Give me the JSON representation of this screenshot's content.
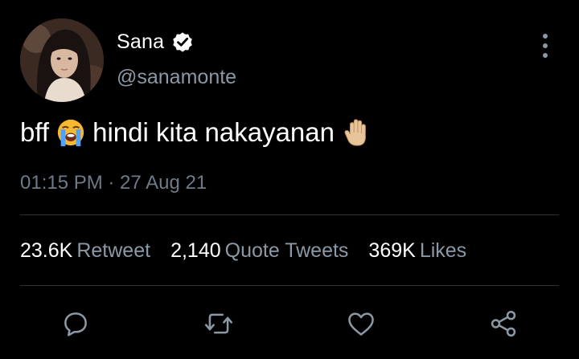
{
  "user": {
    "display_name": "Sana",
    "handle": "@sanamonte",
    "verified": true
  },
  "tweet": {
    "text_part1": "bff",
    "emoji1": "loudly-crying-face",
    "text_part2": "hindi kita nakayanan",
    "emoji2": "raised-hand"
  },
  "timestamp": "01:15 PM · 27 Aug 21",
  "stats": {
    "retweets_count": "23.6K",
    "retweets_label": "Retweet",
    "quotes_count": "2,140",
    "quotes_label": "Quote Tweets",
    "likes_count": "369K",
    "likes_label": "Likes"
  },
  "actions": [
    "reply-icon",
    "retweet-icon",
    "like-icon",
    "share-icon"
  ],
  "colors": {
    "background": "#000000",
    "primary_text": "#ffffff",
    "secondary_text": "#8b98a5",
    "divider": "#2f3336",
    "icon": "#8b98a5"
  }
}
